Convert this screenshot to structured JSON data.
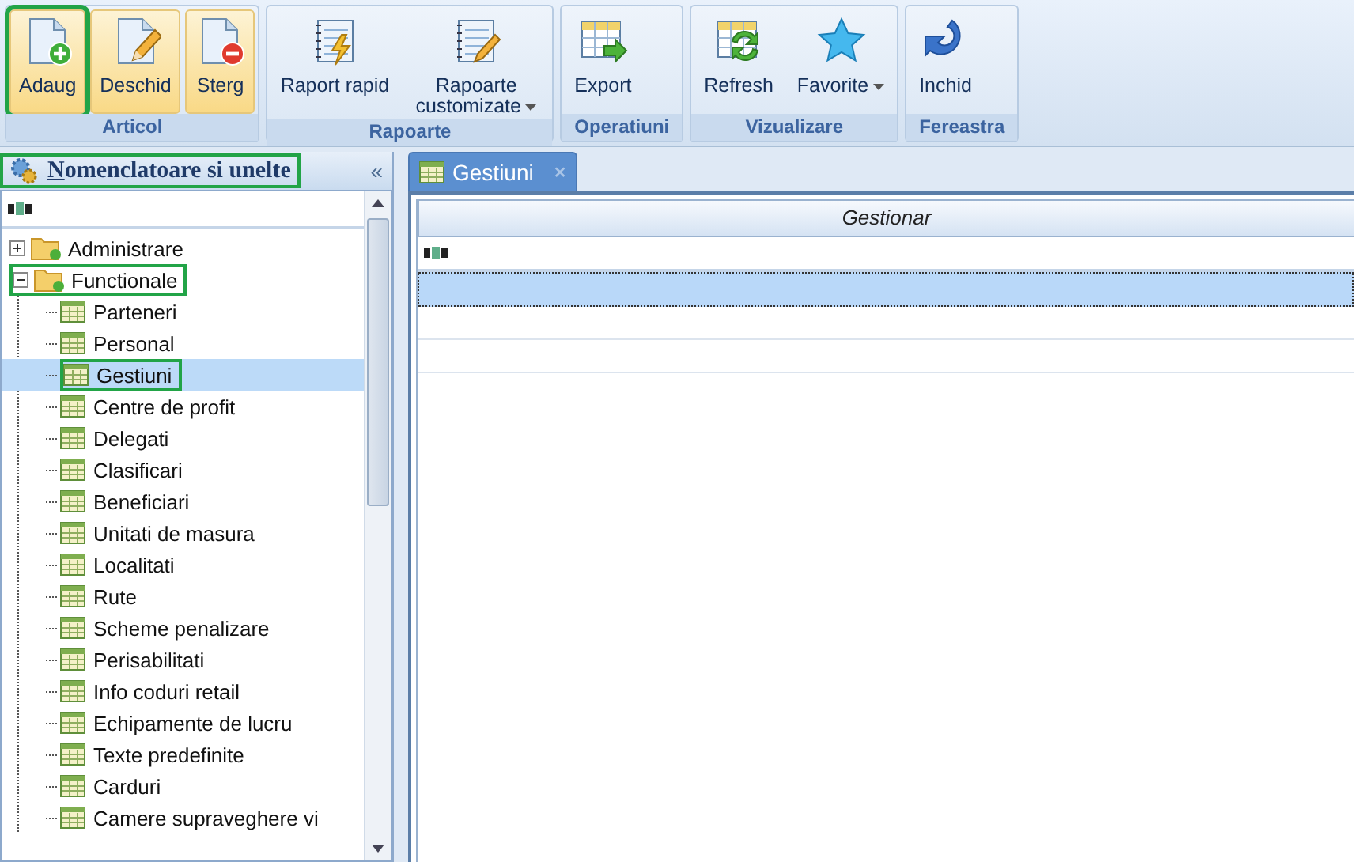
{
  "ribbon": {
    "groups": [
      {
        "label": "Articol",
        "buttons": [
          {
            "label": "Adaug",
            "kind": "add",
            "active": true,
            "outlined": true
          },
          {
            "label": "Deschid",
            "kind": "edit",
            "active": true,
            "outlined": false
          },
          {
            "label": "Sterg",
            "kind": "delete",
            "active": true,
            "outlined": false
          }
        ]
      },
      {
        "label": "Rapoarte",
        "buttons": [
          {
            "label": "Raport rapid",
            "kind": "quick-report",
            "active": false,
            "outlined": false
          },
          {
            "label": "Rapoarte customizate",
            "kind": "custom-report",
            "active": false,
            "outlined": false,
            "dropdown": true
          }
        ]
      },
      {
        "label": "Operatiuni",
        "buttons": [
          {
            "label": "Export",
            "kind": "export",
            "active": false,
            "outlined": false
          }
        ]
      },
      {
        "label": "Vizualizare",
        "buttons": [
          {
            "label": "Refresh",
            "kind": "refresh",
            "active": false,
            "outlined": false
          },
          {
            "label": "Favorite",
            "kind": "star",
            "active": false,
            "outlined": false,
            "dropdown": true
          }
        ]
      },
      {
        "label": "Fereastra",
        "buttons": [
          {
            "label": "Inchid",
            "kind": "close-window",
            "active": false,
            "outlined": false
          }
        ]
      }
    ]
  },
  "sidebar": {
    "title_key": "N",
    "title_rest": "omenclatoare si unelte",
    "outlined": true,
    "collapse": "«",
    "tree": [
      {
        "label": "Administrare",
        "kind": "folder",
        "expanded": false,
        "selected": false,
        "outlined": false
      },
      {
        "label": "Functionale",
        "kind": "folder",
        "expanded": true,
        "selected": false,
        "outlined": true,
        "children": [
          {
            "label": "Parteneri",
            "kind": "table",
            "selected": false,
            "outlined": false
          },
          {
            "label": "Personal",
            "kind": "table",
            "selected": false,
            "outlined": false
          },
          {
            "label": "Gestiuni",
            "kind": "table",
            "selected": true,
            "outlined": true
          },
          {
            "label": "Centre de profit",
            "kind": "table",
            "selected": false,
            "outlined": false
          },
          {
            "label": "Delegati",
            "kind": "table",
            "selected": false,
            "outlined": false
          },
          {
            "label": "Clasificari",
            "kind": "table",
            "selected": false,
            "outlined": false
          },
          {
            "label": "Beneficiari",
            "kind": "table",
            "selected": false,
            "outlined": false
          },
          {
            "label": "Unitati de masura",
            "kind": "table",
            "selected": false,
            "outlined": false
          },
          {
            "label": "Localitati",
            "kind": "table",
            "selected": false,
            "outlined": false
          },
          {
            "label": "Rute",
            "kind": "table",
            "selected": false,
            "outlined": false
          },
          {
            "label": "Scheme penalizare",
            "kind": "table",
            "selected": false,
            "outlined": false
          },
          {
            "label": "Perisabilitati",
            "kind": "table",
            "selected": false,
            "outlined": false
          },
          {
            "label": "Info coduri retail",
            "kind": "table",
            "selected": false,
            "outlined": false
          },
          {
            "label": "Echipamente de lucru",
            "kind": "table",
            "selected": false,
            "outlined": false
          },
          {
            "label": "Texte predefinite",
            "kind": "table",
            "selected": false,
            "outlined": false
          },
          {
            "label": "Carduri",
            "kind": "table",
            "selected": false,
            "outlined": false
          },
          {
            "label": "Camere supraveghere vi",
            "kind": "table",
            "selected": false,
            "outlined": false
          }
        ]
      }
    ]
  },
  "tabs": [
    {
      "label": "Gestiuni",
      "selected": true,
      "close": "×"
    }
  ],
  "table": {
    "columns": [
      "Gestionar"
    ],
    "rows": [
      {
        "selected": true
      },
      {
        "selected": false
      },
      {
        "selected": false
      }
    ]
  }
}
